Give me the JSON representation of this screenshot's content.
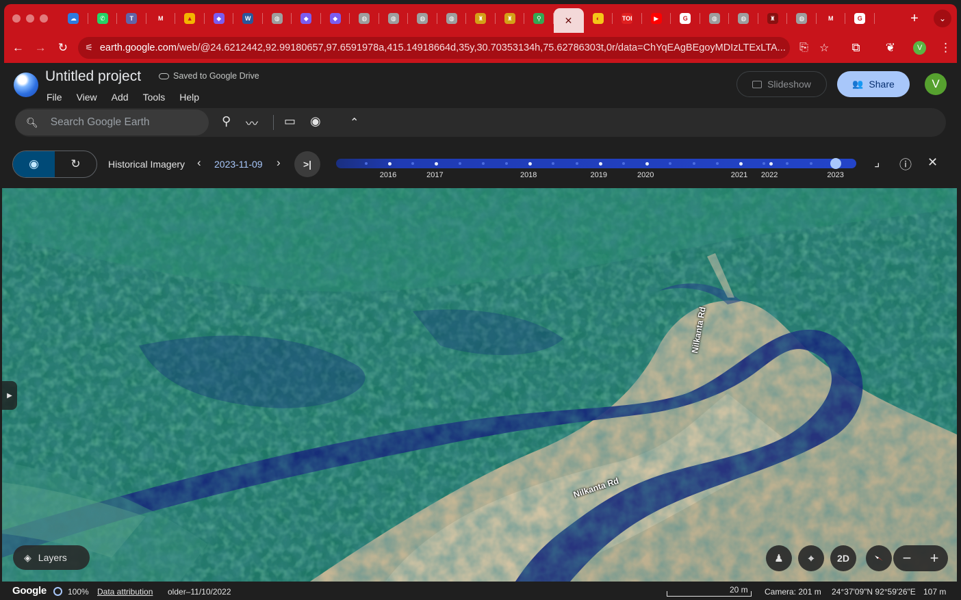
{
  "browser": {
    "tabs": [
      {
        "icon": "onedrive-icon",
        "color": "#2e7be0",
        "glyph": "☁"
      },
      {
        "icon": "whatsapp-icon",
        "color": "#25d366",
        "glyph": "✆"
      },
      {
        "icon": "teams-icon",
        "color": "#6264a7",
        "glyph": "T"
      },
      {
        "icon": "gmail-icon",
        "color": "#c8141b",
        "glyph": "M"
      },
      {
        "icon": "google-drive-icon",
        "color": "#f4b400",
        "glyph": "▲"
      },
      {
        "icon": "copilot-icon",
        "color": "#7b5cf0",
        "glyph": "◆"
      },
      {
        "icon": "word-icon",
        "color": "#2b579a",
        "glyph": "W"
      },
      {
        "icon": "globe-icon",
        "color": "#9e9e9e",
        "glyph": "◍"
      },
      {
        "icon": "copilot-icon",
        "color": "#7b5cf0",
        "glyph": "◆"
      },
      {
        "icon": "copilot-icon",
        "color": "#7b5cf0",
        "glyph": "◆"
      },
      {
        "icon": "globe-icon",
        "color": "#9e9e9e",
        "glyph": "◍"
      },
      {
        "icon": "globe-icon",
        "color": "#9e9e9e",
        "glyph": "◍"
      },
      {
        "icon": "globe-icon",
        "color": "#9e9e9e",
        "glyph": "◍"
      },
      {
        "icon": "globe-icon",
        "color": "#9e9e9e",
        "glyph": "◍"
      },
      {
        "icon": "emblem-icon",
        "color": "#d4a017",
        "glyph": "♜"
      },
      {
        "icon": "emblem-icon",
        "color": "#d4a017",
        "glyph": "♜"
      },
      {
        "icon": "google-maps-icon",
        "color": "#34a853",
        "glyph": "⚲"
      },
      {
        "icon": "close-icon",
        "color": "",
        "glyph": "✕",
        "active": true
      },
      {
        "icon": "google-earth-icon",
        "color": "#f5c518",
        "glyph": "◐"
      },
      {
        "icon": "toi-icon",
        "color": "#e02020",
        "glyph": "TOI"
      },
      {
        "icon": "youtube-icon",
        "color": "#ff0000",
        "glyph": "▶"
      },
      {
        "icon": "google-icon",
        "color": "#ffffff",
        "glyph": "G"
      },
      {
        "icon": "globe-icon",
        "color": "#9e9e9e",
        "glyph": "◍"
      },
      {
        "icon": "globe-icon",
        "color": "#9e9e9e",
        "glyph": "◍"
      },
      {
        "icon": "emblem-icon",
        "color": "#8a1010",
        "glyph": "♜"
      },
      {
        "icon": "globe-icon",
        "color": "#9e9e9e",
        "glyph": "◍"
      },
      {
        "icon": "gmail-icon",
        "color": "#c8141b",
        "glyph": "M"
      },
      {
        "icon": "google-icon",
        "color": "#ffffff",
        "glyph": "G"
      }
    ],
    "url_host": "earth.google.com",
    "url_path": "/web/@24.6212442,92.99180657,97.6591978a,415.14918664d,35y,30.70353134h,75.62786303t,0r/data=ChYqEAgBEgoyMDIzLTExLTA...",
    "profile_initial": "V"
  },
  "project": {
    "title": "Untitled project",
    "saved_status": "Saved to Google Drive",
    "menus": [
      "File",
      "View",
      "Add",
      "Tools",
      "Help"
    ],
    "slideshow_label": "Slideshow",
    "share_label": "Share",
    "user_initial": "V"
  },
  "search": {
    "placeholder": "Search Google Earth"
  },
  "history": {
    "label": "Historical Imagery",
    "date": "2023-11-09",
    "ticks": [
      0.055,
      0.1,
      0.145,
      0.19,
      0.235,
      0.28,
      0.325,
      0.37,
      0.415,
      0.46,
      0.505,
      0.55,
      0.595,
      0.64,
      0.685,
      0.73,
      0.775,
      0.82,
      0.865,
      0.91
    ],
    "major_ticks": [
      0.1,
      0.19,
      0.37,
      0.505,
      0.595,
      0.775,
      0.833
    ],
    "years": [
      {
        "label": "2016",
        "pos": 0.1
      },
      {
        "label": "2017",
        "pos": 0.19
      },
      {
        "label": "2018",
        "pos": 0.37
      },
      {
        "label": "2019",
        "pos": 0.505
      },
      {
        "label": "2020",
        "pos": 0.595
      },
      {
        "label": "2021",
        "pos": 0.775
      },
      {
        "label": "2022",
        "pos": 0.833
      },
      {
        "label": "2023",
        "pos": 0.96
      }
    ],
    "selected_pos": 0.96
  },
  "map": {
    "road_labels": [
      "Nilkanta Rd",
      "Nilkanta Rd"
    ],
    "layers_label": "Layers",
    "view_mode_label": "2D"
  },
  "statusbar": {
    "brand": "Google",
    "load_percent": "100%",
    "attribution_label": "Data attribution",
    "imagery_date": "older–11/10/2022",
    "scale_label": "20 m",
    "camera": "Camera: 201 m",
    "coords": "24°37'09\"N 92°59'26\"E",
    "elevation": "107 m"
  }
}
